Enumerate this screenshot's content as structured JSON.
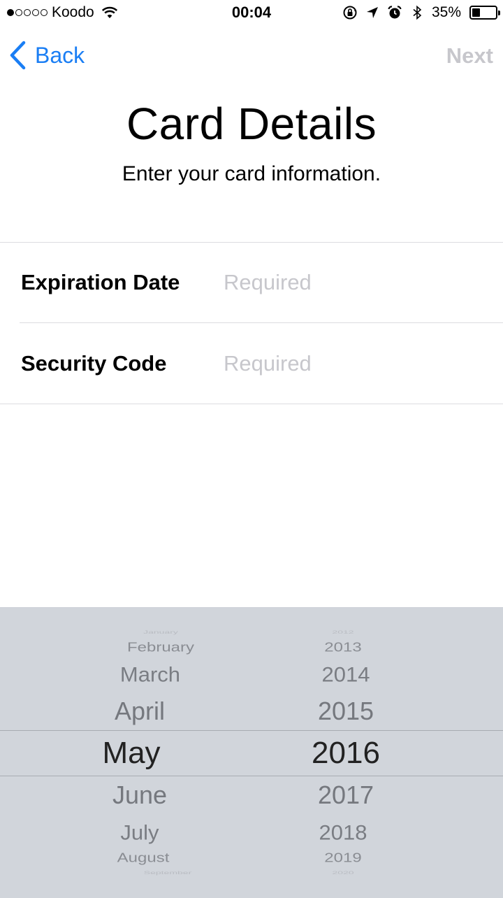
{
  "status_bar": {
    "carrier": "Koodo",
    "time": "00:04",
    "battery_percent": "35%",
    "battery_level": 0.35,
    "signal_strength": 1,
    "icons": [
      "wifi-icon",
      "orientation-lock-icon",
      "location-icon",
      "alarm-icon",
      "bluetooth-icon",
      "battery-icon"
    ]
  },
  "nav": {
    "back_label": "Back",
    "next_label": "Next",
    "accent_color": "#1a7ef4",
    "disabled_color": "#c7c7cc"
  },
  "header": {
    "title": "Card Details",
    "subtitle": "Enter your card information."
  },
  "form": {
    "fields": [
      {
        "label": "Expiration Date",
        "placeholder": "Required",
        "value": ""
      },
      {
        "label": "Security Code",
        "placeholder": "Required",
        "value": ""
      }
    ]
  },
  "picker": {
    "months": [
      "January",
      "February",
      "March",
      "April",
      "May",
      "June",
      "July",
      "August",
      "September"
    ],
    "years": [
      "2012",
      "2013",
      "2014",
      "2015",
      "2016",
      "2017",
      "2018",
      "2019",
      "2020"
    ],
    "selected_month": "May",
    "selected_year": "2016",
    "background_color": "#d1d5db"
  }
}
